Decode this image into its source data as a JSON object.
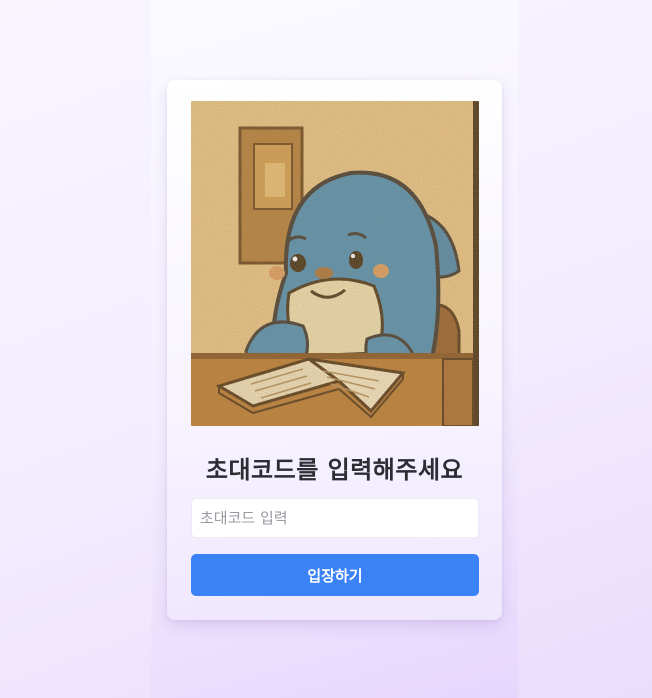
{
  "invite": {
    "title": "초대코드를 입력해주세요",
    "input_placeholder": "초대코드 입력",
    "input_value": "",
    "submit_label": "입장하기"
  },
  "colors": {
    "accent": "#3b82f6",
    "card_background": "#ffffff",
    "title_text": "#2b2d33",
    "placeholder_text": "#9a9aa2"
  },
  "illustration": {
    "subject": "blue-seal-mascot-reading-book",
    "style": "grainy-storybook"
  }
}
